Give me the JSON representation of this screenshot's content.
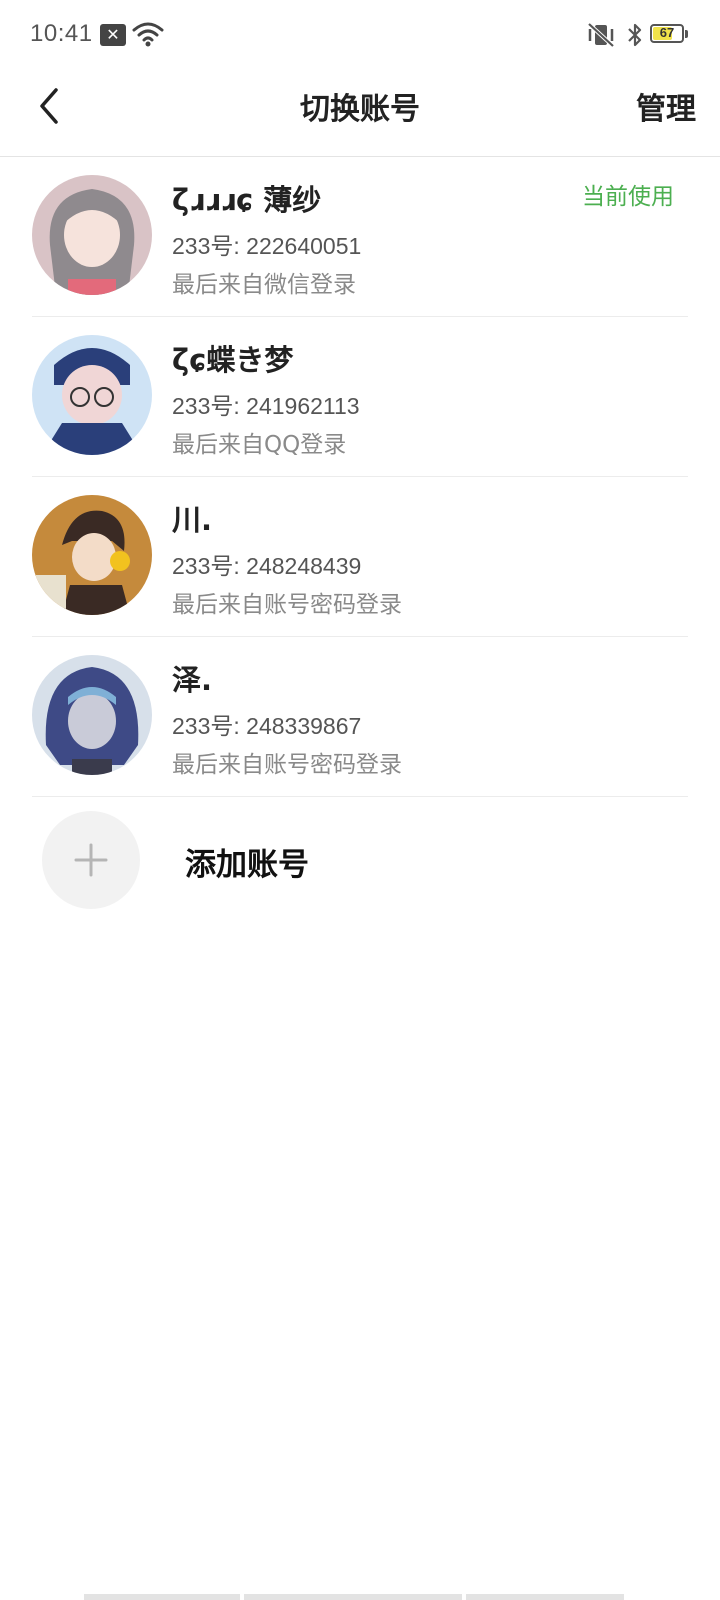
{
  "status_bar": {
    "time": "10:41",
    "battery": "67",
    "battery_level": 0.67
  },
  "header": {
    "title": "切换账号",
    "manage_label": "管理"
  },
  "accounts": [
    {
      "name": "ζɹɹɹɕ 薄纱",
      "uid": "233号: 222640051",
      "login_source": "最后来自微信登录",
      "current_label": "当前使用",
      "avatar_colors": [
        "#d9c3c6",
        "#8f8a8e",
        "#e36a7b"
      ]
    },
    {
      "name": "ζɕ蝶き梦",
      "uid": "233号: 241962113",
      "login_source": "最后来自QQ登录",
      "avatar_colors": [
        "#cfe3f5",
        "#2a3f7a",
        "#f0d6d6"
      ]
    },
    {
      "name": "川.",
      "uid": "233号: 248248439",
      "login_source": "最后来自账号密码登录",
      "avatar_colors": [
        "#c58a3c",
        "#3a2a24",
        "#f2c21f"
      ]
    },
    {
      "name": "泽.",
      "uid": "233号: 248339867",
      "login_source": "最后来自账号密码登录",
      "avatar_colors": [
        "#d7e0ea",
        "#3e4a86",
        "#7fb0d6"
      ]
    }
  ],
  "add_account": {
    "label": "添加账号",
    "icon": "plus-icon"
  },
  "colors": {
    "accent_green": "#4caf50",
    "divider": "#ececec"
  }
}
